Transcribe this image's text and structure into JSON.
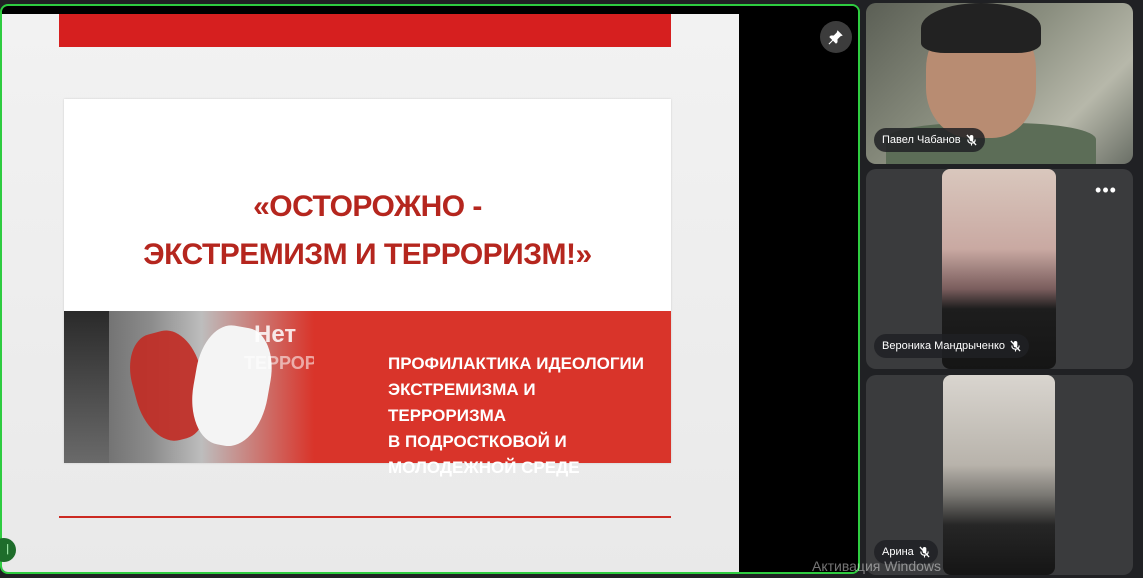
{
  "shared_screen": {
    "slide": {
      "title_lines": [
        "«ОСТОРОЖНО -",
        "ЭКСТРЕМИЗМ И ТЕРРОРИЗМ!»"
      ],
      "band_text_lines": [
        "ПРОФИЛАКТИКА ИДЕОЛОГИИ",
        "ЭКСТРЕМИЗМА И ТЕРРОРИЗМА",
        "В ПОДРОСТКОВОЙ И",
        "МОЛОДЕЖНОЙ СРЕДЕ"
      ],
      "image_text": [
        "Нет",
        "ТЕРРОРИЗМУ"
      ]
    },
    "pin_icon": "pin-icon"
  },
  "participants": [
    {
      "name": "Павел Чабанов",
      "mic": "muted"
    },
    {
      "name": "Вероника Мандрыченко",
      "mic": "muted"
    },
    {
      "name": "Арина",
      "mic": "muted"
    }
  ],
  "more_options": "•••",
  "watermark": "Активация Windows",
  "colors": {
    "speaker_border": "#2ecc40",
    "slide_red": "#d9342a",
    "title_red": "#b5261e"
  }
}
